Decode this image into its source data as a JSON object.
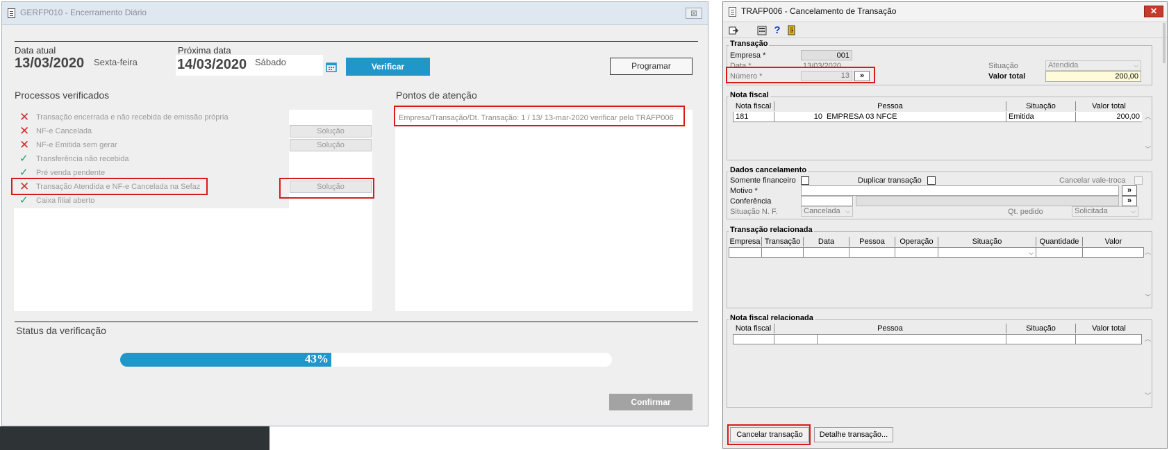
{
  "w1": {
    "title": "GERFP010 - Encerramento Diário",
    "close": "⊠",
    "data_atual_label": "Data atual",
    "data_atual": "13/03/2020",
    "dia_atual": "Sexta-feira",
    "proxima_label": "Próxima data",
    "proxima": "14/03/2020",
    "dia_proxima": "Sábado",
    "verificar": "Verificar",
    "programar": "Programar",
    "processos_title": "Processos verificados",
    "pontos_title": "Pontos de atenção",
    "processos": [
      {
        "status": "error",
        "text": "Transação encerrada e não recebida de emissão própria"
      },
      {
        "status": "error",
        "text": "NF-e Cancelada"
      },
      {
        "status": "error",
        "text": "NF-e Emitida sem gerar"
      },
      {
        "status": "ok",
        "text": "Transferência não recebida"
      },
      {
        "status": "ok",
        "text": "Pré venda pendente"
      },
      {
        "status": "error",
        "text": "Transação Atendida e NF-e Cancelada na Sefaz"
      },
      {
        "status": "ok",
        "text": "Caixa filial aberto"
      }
    ],
    "solucao": "Solução",
    "ponto": "Empresa/Transação/Dt. Transação: 1 / 13/ 13-mar-2020 verificar pelo TRAFP006",
    "status_title": "Status da verificação",
    "progress": 0.43,
    "progress_label": "43%",
    "confirmar": "Confirmar",
    "colors": {
      "accent": "#2196c8",
      "error": "#d32f2f",
      "ok": "#1b9e6d",
      "highlight": "#d91a1a"
    }
  },
  "w2": {
    "title": "TRAFP006 - Cancelamento de Transação",
    "close": "✕",
    "toolbar": [
      "exit-icon",
      "calculator-icon",
      "help-icon",
      "door-icon"
    ],
    "transacao": {
      "group": "Transação",
      "empresa_label": "Empresa *",
      "empresa": "001",
      "data_label": "Data *",
      "data": "13/03/2020",
      "numero_label": "Número *",
      "numero": "13",
      "situacao_label": "Situação",
      "situacao": "Atendida",
      "valor_label": "Valor total",
      "valor": "200,00",
      "btn": "»"
    },
    "nota": {
      "group": "Nota fiscal",
      "headers": [
        "Nota fiscal",
        "Pessoa",
        "Situação",
        "Valor total"
      ],
      "row": {
        "nota": "181",
        "pessoa_cod": "10",
        "pessoa": "EMPRESA 03 NFCE",
        "situacao": "Emitida",
        "valor": "200,00"
      }
    },
    "dados": {
      "group": "Dados cancelamento",
      "somente": "Somente financeiro",
      "duplicar": "Duplicar transação",
      "vale": "Cancelar vale-troca",
      "motivo": "Motivo *",
      "conferencia": "Conferência",
      "sit_nf_label": "Situação N. F.",
      "sit_nf": "Cancelada",
      "qt_label": "Qt. pedido",
      "qt": "Solicitada",
      "btn": "»"
    },
    "rel": {
      "group": "Transação relacionada",
      "headers": [
        "Empresa",
        "Transação",
        "Data",
        "Pessoa",
        "Operação",
        "Situação",
        "Quantidade",
        "Valor"
      ]
    },
    "nfrel": {
      "group": "Nota fiscal relacionada",
      "headers": [
        "Nota fiscal",
        "Pessoa",
        "Situação",
        "Valor total"
      ]
    },
    "cancelar": "Cancelar transação",
    "detalhe": "Detalhe transação..."
  }
}
